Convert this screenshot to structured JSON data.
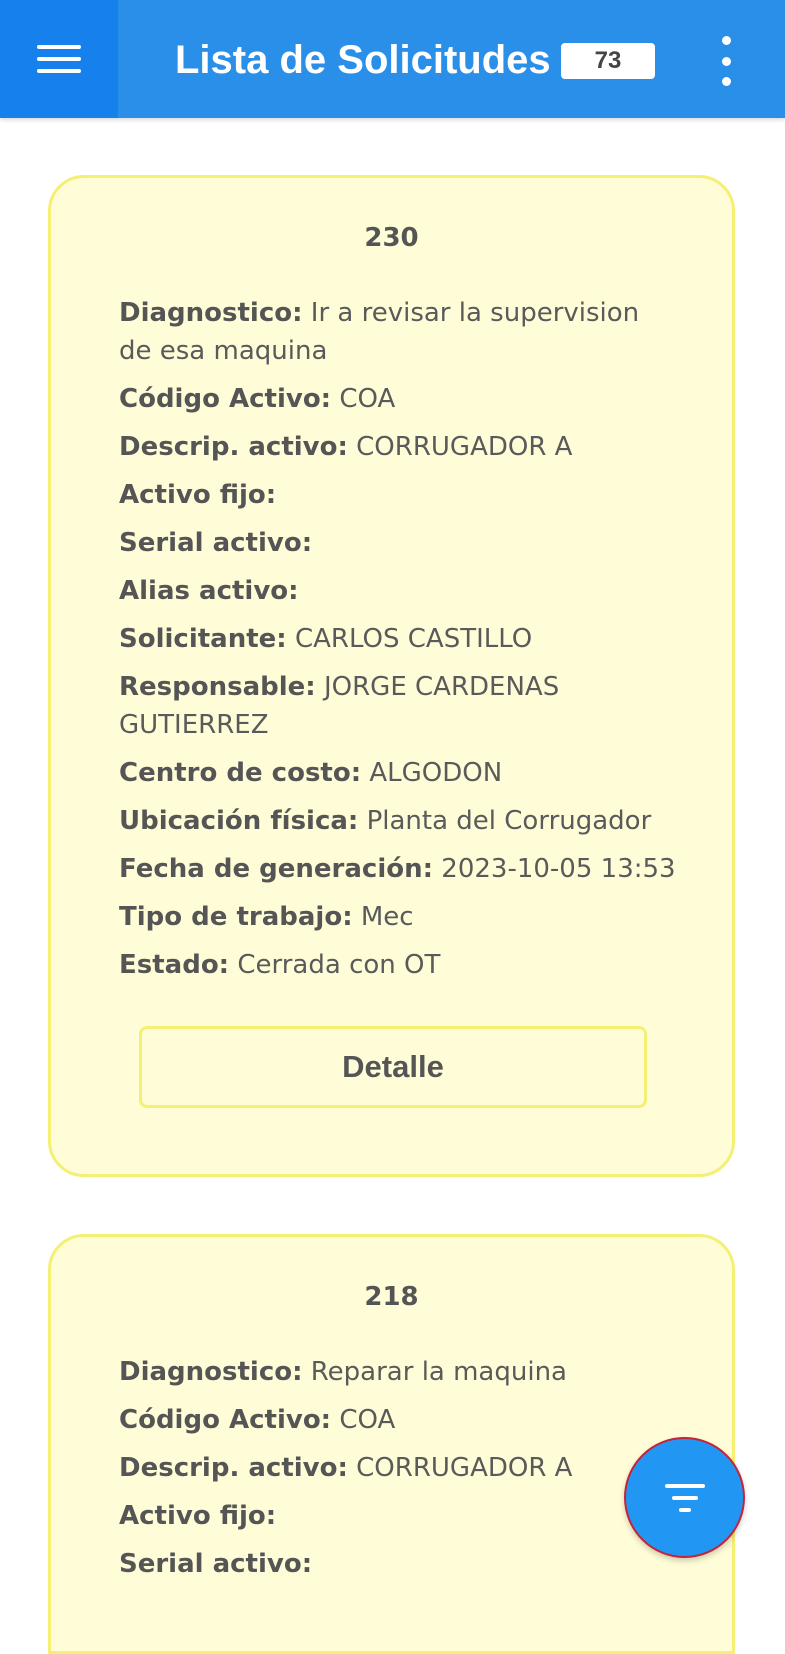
{
  "header": {
    "title": "Lista de Solicitudes",
    "count": "73",
    "menu_icon": "hamburger-menu-icon",
    "overflow_icon": "more-vert-icon"
  },
  "colors": {
    "appbar": "#2a8fe9",
    "appbar_menu": "#1681ec",
    "card_bg": "#fffdd8",
    "card_border": "#f5ef74",
    "fab": "#2196f3"
  },
  "cards": [
    {
      "id": "230",
      "fields": [
        {
          "label": "Diagnostico:",
          "value": "Ir a revisar la supervision de esa maquina"
        },
        {
          "label": "Código Activo:",
          "value": "COA"
        },
        {
          "label": "Descrip. activo:",
          "value": "CORRUGADOR A"
        },
        {
          "label": "Activo fijo:",
          "value": ""
        },
        {
          "label": "Serial activo:",
          "value": ""
        },
        {
          "label": "Alias activo:",
          "value": ""
        },
        {
          "label": "Solicitante:",
          "value": "CARLOS CASTILLO"
        },
        {
          "label": "Responsable:",
          "value": "JORGE CARDENAS GUTIERREZ"
        },
        {
          "label": "Centro de costo:",
          "value": "ALGODON"
        },
        {
          "label": "Ubicación física:",
          "value": "Planta del Corrugador"
        },
        {
          "label": "Fecha de generación:",
          "value": "2023-10-05 13:53"
        },
        {
          "label": "Tipo de trabajo:",
          "value": "Mec"
        },
        {
          "label": "Estado:",
          "value": "Cerrada con OT"
        }
      ],
      "detail_label": "Detalle"
    },
    {
      "id": "218",
      "fields": [
        {
          "label": "Diagnostico:",
          "value": "Reparar la maquina"
        },
        {
          "label": "Código Activo:",
          "value": "COA"
        },
        {
          "label": "Descrip. activo:",
          "value": "CORRUGADOR A"
        },
        {
          "label": "Activo fijo:",
          "value": ""
        },
        {
          "label": "Serial activo:",
          "value": ""
        }
      ]
    }
  ],
  "fab": {
    "icon": "filter-icon"
  }
}
